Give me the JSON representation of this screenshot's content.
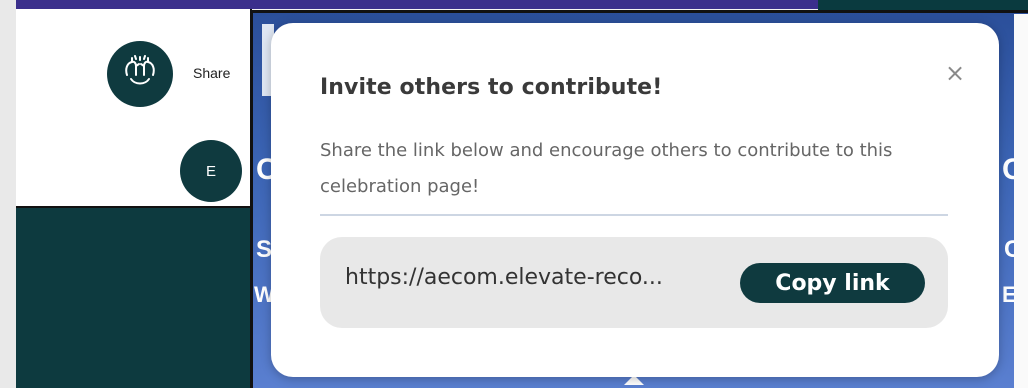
{
  "background": {
    "share_peek": "Share",
    "avatar_initial": "E",
    "banner_letters": [
      "C",
      "S",
      "W",
      "C",
      "C",
      "E"
    ]
  },
  "modal": {
    "title": "Invite others to contribute!",
    "close_label": "×",
    "description": "Share the link below and encourage others to contribute to this celebration page!",
    "link_value": "https://aecom.elevate-reco...",
    "copy_button": "Copy link"
  },
  "colors": {
    "brand_dark": "#0f3a3f",
    "banner_blue": "#3b64b4",
    "top_bar": "#3b2f8c"
  },
  "icons": {
    "emblem": "hands-celebration-icon",
    "close": "close-icon"
  }
}
